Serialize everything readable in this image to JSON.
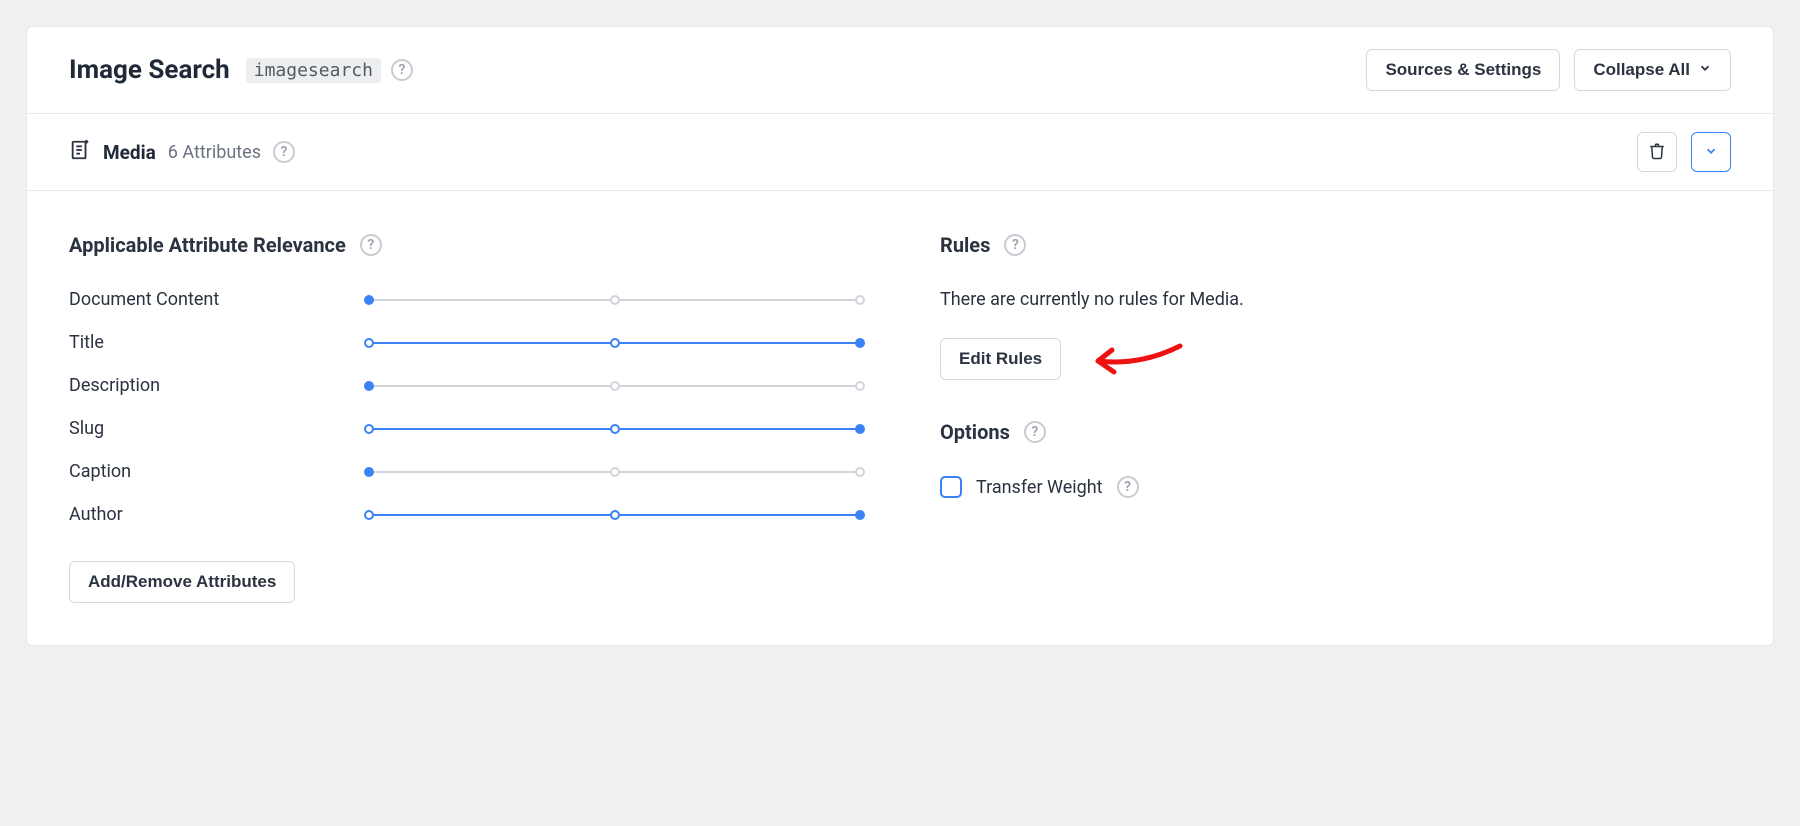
{
  "header": {
    "title": "Image Search",
    "code": "imagesearch",
    "sources_settings_label": "Sources & Settings",
    "collapse_all_label": "Collapse All"
  },
  "section": {
    "name": "Media",
    "attribute_count_label": "6 Attributes"
  },
  "relevance": {
    "heading": "Applicable Attribute Relevance",
    "attributes": [
      {
        "label": "Document Content",
        "value": 0
      },
      {
        "label": "Title",
        "value": 2
      },
      {
        "label": "Description",
        "value": 0
      },
      {
        "label": "Slug",
        "value": 2
      },
      {
        "label": "Caption",
        "value": 0
      },
      {
        "label": "Author",
        "value": 2
      }
    ],
    "add_remove_label": "Add/Remove Attributes"
  },
  "rules": {
    "heading": "Rules",
    "empty_text": "There are currently no rules for Media.",
    "edit_label": "Edit Rules"
  },
  "options": {
    "heading": "Options",
    "transfer_weight_label": "Transfer Weight"
  }
}
